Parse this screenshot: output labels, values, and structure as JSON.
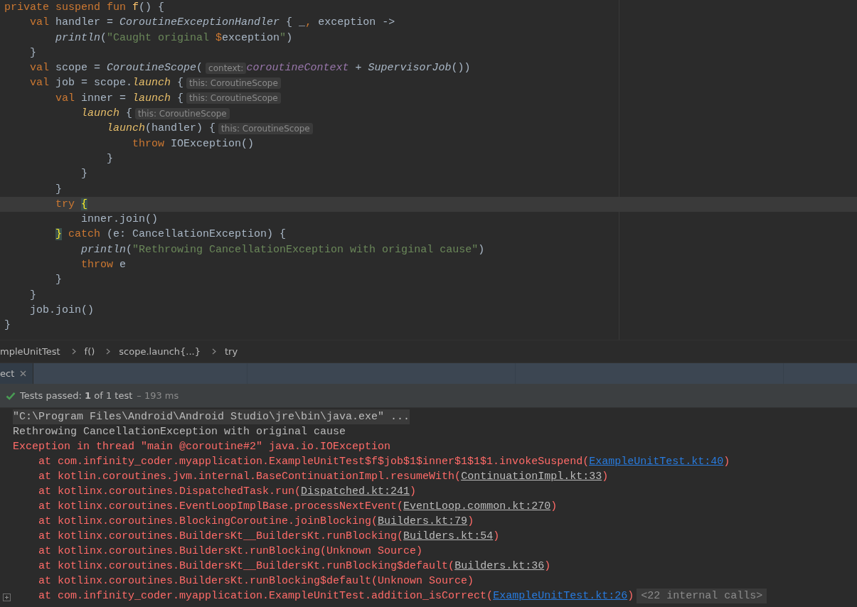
{
  "editor": {
    "lines": [
      {
        "current": false,
        "segments": [
          {
            "kind": "code",
            "tokens": [
              {
                "t": "private suspend fun ",
                "kind": "kw"
              },
              {
                "t": "f",
                "kind": "fn"
              },
              {
                "t": "() {",
                "kind": "plain"
              }
            ]
          }
        ]
      },
      {
        "current": false,
        "segments": [
          {
            "kind": "code",
            "tokens": [
              {
                "t": "    val",
                "kind": "kw"
              },
              {
                "t": " handler = ",
                "kind": "plain"
              },
              {
                "t": "CoroutineExceptionHandler",
                "kind": "italic"
              },
              {
                "t": " { _",
                "kind": "plain"
              },
              {
                "t": ",",
                "kind": "kw"
              },
              {
                "t": " exception ->",
                "kind": "plain"
              }
            ]
          }
        ]
      },
      {
        "current": false,
        "segments": [
          {
            "kind": "code",
            "tokens": [
              {
                "t": "        println",
                "kind": "italic"
              },
              {
                "t": "(",
                "kind": "plain"
              },
              {
                "t": "\"Caught original ",
                "kind": "str"
              },
              {
                "t": "$",
                "kind": "kw"
              },
              {
                "t": "exception",
                "kind": "plain"
              },
              {
                "t": "\"",
                "kind": "str"
              },
              {
                "t": ")",
                "kind": "plain"
              }
            ]
          }
        ]
      },
      {
        "current": false,
        "segments": [
          {
            "kind": "code",
            "tokens": [
              {
                "t": "    }",
                "kind": "plain"
              }
            ]
          }
        ]
      },
      {
        "current": false,
        "segments": [
          {
            "kind": "code",
            "tokens": [
              {
                "t": "    val",
                "kind": "kw"
              },
              {
                "t": " scope = ",
                "kind": "plain"
              },
              {
                "t": "CoroutineScope",
                "kind": "italic"
              },
              {
                "t": "(",
                "kind": "plain"
              }
            ]
          },
          {
            "kind": "hint",
            "text": "context:"
          },
          {
            "kind": "code",
            "tokens": [
              {
                "t": "coroutineContext",
                "kind": "prop"
              },
              {
                "t": " + ",
                "kind": "plain"
              },
              {
                "t": "SupervisorJob",
                "kind": "italic"
              },
              {
                "t": "())",
                "kind": "plain"
              }
            ]
          }
        ]
      },
      {
        "current": false,
        "segments": [
          {
            "kind": "code",
            "tokens": [
              {
                "t": "    val",
                "kind": "kw"
              },
              {
                "t": " job = scope.",
                "kind": "plain"
              },
              {
                "t": "launch",
                "kind": "call"
              },
              {
                "t": " {",
                "kind": "plain"
              }
            ]
          },
          {
            "kind": "hint",
            "text": "this: CoroutineScope"
          }
        ]
      },
      {
        "current": false,
        "segments": [
          {
            "kind": "code",
            "tokens": [
              {
                "t": "        val",
                "kind": "kw"
              },
              {
                "t": " inner = ",
                "kind": "plain"
              },
              {
                "t": "launch",
                "kind": "call"
              },
              {
                "t": " {",
                "kind": "plain"
              }
            ]
          },
          {
            "kind": "hint",
            "text": "this: CoroutineScope"
          }
        ]
      },
      {
        "current": false,
        "segments": [
          {
            "kind": "code",
            "tokens": [
              {
                "t": "            launch",
                "kind": "call"
              },
              {
                "t": " {",
                "kind": "plain"
              }
            ]
          },
          {
            "kind": "hint",
            "text": "this: CoroutineScope"
          }
        ]
      },
      {
        "current": false,
        "segments": [
          {
            "kind": "code",
            "tokens": [
              {
                "t": "                launch",
                "kind": "call"
              },
              {
                "t": "(handler) {",
                "kind": "plain"
              }
            ]
          },
          {
            "kind": "hint",
            "text": "this: CoroutineScope"
          }
        ]
      },
      {
        "current": false,
        "segments": [
          {
            "kind": "code",
            "tokens": [
              {
                "t": "                    throw",
                "kind": "kw"
              },
              {
                "t": " IOException()",
                "kind": "plain"
              }
            ]
          }
        ]
      },
      {
        "current": false,
        "segments": [
          {
            "kind": "code",
            "tokens": [
              {
                "t": "                }",
                "kind": "plain"
              }
            ]
          }
        ]
      },
      {
        "current": false,
        "segments": [
          {
            "kind": "code",
            "tokens": [
              {
                "t": "            }",
                "kind": "plain"
              }
            ]
          }
        ]
      },
      {
        "current": false,
        "segments": [
          {
            "kind": "code",
            "tokens": [
              {
                "t": "        }",
                "kind": "plain"
              }
            ]
          }
        ]
      },
      {
        "current": true,
        "segments": [
          {
            "kind": "code",
            "tokens": [
              {
                "t": "        try ",
                "kind": "kw"
              },
              {
                "t": "{",
                "kind": "match"
              }
            ]
          }
        ]
      },
      {
        "current": false,
        "segments": [
          {
            "kind": "code",
            "tokens": [
              {
                "t": "            inner.join()",
                "kind": "plain"
              }
            ]
          }
        ]
      },
      {
        "current": false,
        "segments": [
          {
            "kind": "code",
            "tokens": [
              {
                "t": "        }",
                "kind": "match"
              },
              {
                "t": " catch",
                "kind": "kw"
              },
              {
                "t": " (e: CancellationException) {",
                "kind": "plain"
              }
            ]
          }
        ]
      },
      {
        "current": false,
        "segments": [
          {
            "kind": "code",
            "tokens": [
              {
                "t": "            println",
                "kind": "italic"
              },
              {
                "t": "(",
                "kind": "plain"
              },
              {
                "t": "\"Rethrowing CancellationException with original cause\"",
                "kind": "str"
              },
              {
                "t": ")",
                "kind": "plain"
              }
            ]
          }
        ]
      },
      {
        "current": false,
        "segments": [
          {
            "kind": "code",
            "tokens": [
              {
                "t": "            throw",
                "kind": "kw"
              },
              {
                "t": " e",
                "kind": "plain"
              }
            ]
          }
        ]
      },
      {
        "current": false,
        "segments": [
          {
            "kind": "code",
            "tokens": [
              {
                "t": "        }",
                "kind": "plain"
              }
            ]
          }
        ]
      },
      {
        "current": false,
        "segments": [
          {
            "kind": "code",
            "tokens": [
              {
                "t": "    }",
                "kind": "plain"
              }
            ]
          }
        ]
      },
      {
        "current": false,
        "segments": [
          {
            "kind": "code",
            "tokens": [
              {
                "t": "    job.join()",
                "kind": "plain"
              }
            ]
          }
        ]
      },
      {
        "current": false,
        "segments": [
          {
            "kind": "code",
            "tokens": [
              {
                "t": "}",
                "kind": "plain"
              }
            ]
          }
        ]
      }
    ]
  },
  "breadcrumbs": [
    "mpleUnitTest",
    "f()",
    "scope.launch{...}",
    "try"
  ],
  "tool_tabs": [
    {
      "label": "ect",
      "selected": true
    }
  ],
  "status": {
    "passed": true,
    "summary": "Tests passed: **1** of 1 test",
    "duration": "– 193 ms"
  },
  "console": {
    "lines": [
      {
        "kind": "command",
        "parts": [
          {
            "kind": "text",
            "t": "\"C:\\Program Files\\Android\\Android Studio\\jre\\bin\\java.exe\" ..."
          }
        ]
      },
      {
        "kind": "output",
        "parts": [
          {
            "kind": "text",
            "t": "Rethrowing CancellationException with original cause"
          }
        ]
      },
      {
        "kind": "error",
        "parts": [
          {
            "kind": "text",
            "t": "Exception in thread \"main @coroutine#2\" java.io.IOException"
          }
        ]
      },
      {
        "kind": "error",
        "parts": [
          {
            "kind": "text",
            "t": "    at com.infinity_coder.myapplication.ExampleUnitTest$f$job$1$inner$1$1$1.invokeSuspend("
          },
          {
            "kind": "link",
            "t": "ExampleUnitTest.kt:40"
          },
          {
            "kind": "text",
            "t": ")"
          }
        ]
      },
      {
        "kind": "error",
        "parts": [
          {
            "kind": "text",
            "t": "    at kotlin.coroutines.jvm.internal.BaseContinuationImpl.resumeWith("
          },
          {
            "kind": "library",
            "t": "ContinuationImpl.kt:33"
          },
          {
            "kind": "text",
            "t": ")"
          }
        ]
      },
      {
        "kind": "error",
        "parts": [
          {
            "kind": "text",
            "t": "    at kotlinx.coroutines.DispatchedTask.run("
          },
          {
            "kind": "library",
            "t": "Dispatched.kt:241"
          },
          {
            "kind": "text",
            "t": ")"
          }
        ]
      },
      {
        "kind": "error",
        "parts": [
          {
            "kind": "text",
            "t": "    at kotlinx.coroutines.EventLoopImplBase.processNextEvent("
          },
          {
            "kind": "library",
            "t": "EventLoop.common.kt:270"
          },
          {
            "kind": "text",
            "t": ")"
          }
        ]
      },
      {
        "kind": "error",
        "parts": [
          {
            "kind": "text",
            "t": "    at kotlinx.coroutines.BlockingCoroutine.joinBlocking("
          },
          {
            "kind": "library",
            "t": "Builders.kt:79"
          },
          {
            "kind": "text",
            "t": ")"
          }
        ]
      },
      {
        "kind": "error",
        "parts": [
          {
            "kind": "text",
            "t": "    at kotlinx.coroutines.BuildersKt__BuildersKt.runBlocking("
          },
          {
            "kind": "library",
            "t": "Builders.kt:54"
          },
          {
            "kind": "text",
            "t": ")"
          }
        ]
      },
      {
        "kind": "error",
        "parts": [
          {
            "kind": "text",
            "t": "    at kotlinx.coroutines.BuildersKt.runBlocking(Unknown Source)"
          }
        ]
      },
      {
        "kind": "error",
        "parts": [
          {
            "kind": "text",
            "t": "    at kotlinx.coroutines.BuildersKt__BuildersKt.runBlocking$default("
          },
          {
            "kind": "library",
            "t": "Builders.kt:36"
          },
          {
            "kind": "text",
            "t": ")"
          }
        ]
      },
      {
        "kind": "error",
        "parts": [
          {
            "kind": "text",
            "t": "    at kotlinx.coroutines.BuildersKt.runBlocking$default(Unknown Source)"
          }
        ]
      },
      {
        "kind": "error",
        "parts": [
          {
            "kind": "text",
            "t": "    at com.infinity_coder.myapplication.ExampleUnitTest.addition_isCorrect("
          },
          {
            "kind": "link",
            "t": "ExampleUnitTest.kt:26"
          },
          {
            "kind": "text",
            "t": ")"
          }
        ],
        "folded": "<22 internal calls>"
      }
    ]
  }
}
